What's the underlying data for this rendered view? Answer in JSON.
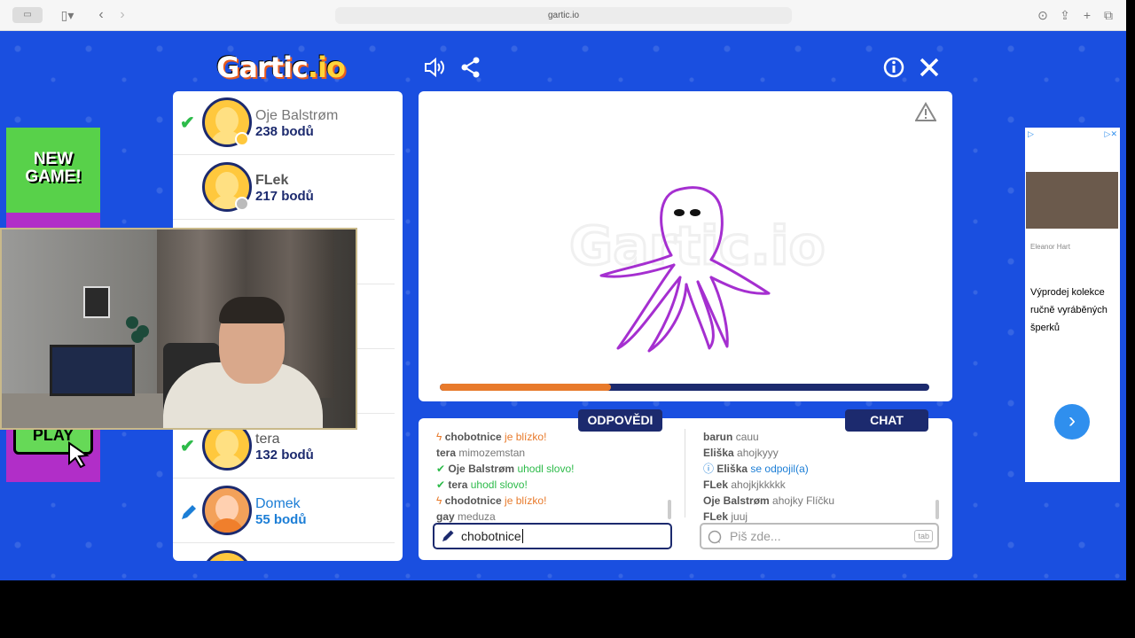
{
  "browser": {
    "url": "gartic.io"
  },
  "game": {
    "logo_main": "Gartic",
    "logo_io": ".io",
    "players": [
      {
        "name": "Oje Balstrøm",
        "points": "238 bodů",
        "checked": true
      },
      {
        "name": "FLek",
        "points": "217 bodů",
        "checked": false
      },
      {
        "name": "tera",
        "points": "132 bodů",
        "checked": true
      },
      {
        "name": "Domek",
        "points": "55 bodů",
        "drawing": true
      }
    ],
    "progress_fraction": 0.35,
    "answers_tab": "ODPOVĚDI",
    "chat_tab": "CHAT",
    "answers": [
      {
        "user": "chobotnice",
        "text": "je blízko!",
        "type": "close"
      },
      {
        "user": "tera",
        "text": "mimozemstan",
        "type": "plain"
      },
      {
        "user": "Oje Balstrøm",
        "text": "uhodl slovo!",
        "type": "correct"
      },
      {
        "user": "tera",
        "text": "uhodl slovo!",
        "type": "correct"
      },
      {
        "user": "chodotnice",
        "text": "je blízko!",
        "type": "close"
      },
      {
        "user": "gay",
        "text": "meduza",
        "type": "plain"
      }
    ],
    "chat": [
      {
        "user": "barun",
        "text": "cauu",
        "type": "plain"
      },
      {
        "user": "Eliška",
        "text": "ahojkyyy",
        "type": "plain"
      },
      {
        "user": "Eliška",
        "text": "se odpojil(a)",
        "type": "info"
      },
      {
        "user": "FLek",
        "text": "ahojkjkkkkk",
        "type": "plain"
      },
      {
        "user": "Oje Balstrøm",
        "text": "ahojky Flíčku",
        "type": "plain"
      },
      {
        "user": "FLek",
        "text": "juuj",
        "type": "plain"
      }
    ],
    "answer_input_value": "chobotnice",
    "chat_input_placeholder": "Piš zde...",
    "chat_input_hint": "tab"
  },
  "ads": {
    "left_headline": "NEW GAME!",
    "left_button": "PLAY",
    "right_brand": "Eleanor Hart",
    "right_text": "Výprodej kolekce ručně vyráběných šperků"
  },
  "colors": {
    "background": "#1a4fe0",
    "navy": "#1c2a6e",
    "progress": "#e87a2b",
    "correct": "#2dbb4a",
    "drawing": "#a52fd0"
  }
}
